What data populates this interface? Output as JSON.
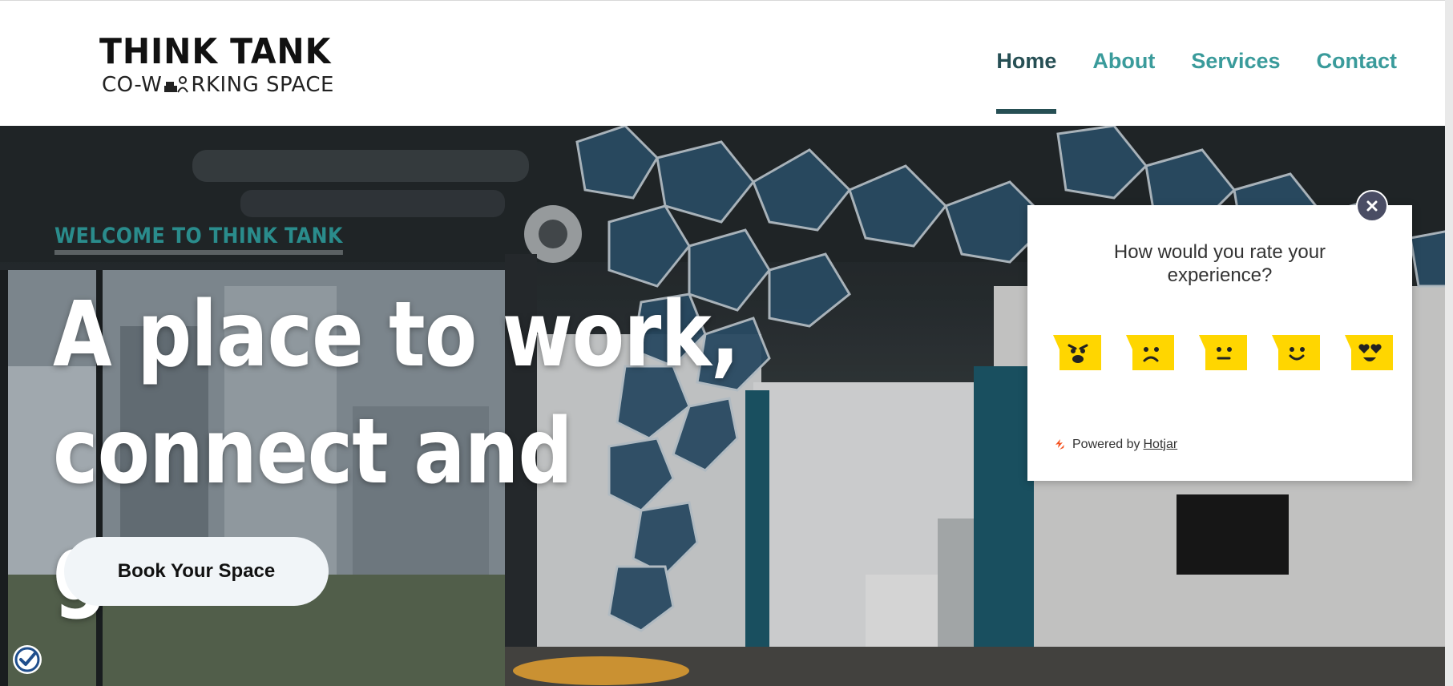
{
  "brand": {
    "title": "THINK TANK",
    "subtitle_left": "CO-W",
    "subtitle_right": "RKING SPACE",
    "accent_color": "#3a9b9b",
    "dark_color": "#264f54"
  },
  "nav": {
    "items": [
      {
        "label": "Home",
        "active": true
      },
      {
        "label": "About",
        "active": false
      },
      {
        "label": "Services",
        "active": false
      },
      {
        "label": "Contact",
        "active": false
      }
    ]
  },
  "hero": {
    "eyebrow": "WELCOME TO THINK TANK",
    "headline_line1": "A place to work,",
    "headline_line2": "connect and grow",
    "cta_label": "Book Your Space",
    "badge_icon": "shield-check-icon"
  },
  "survey": {
    "question": "How would you rate your experience?",
    "close_icon": "close-icon",
    "ratings": [
      "angry-face-icon",
      "sad-face-icon",
      "neutral-face-icon",
      "happy-face-icon",
      "love-face-icon"
    ],
    "powered_prefix": "Powered by",
    "powered_link": "Hotjar",
    "emoji_color": "#ffd600"
  }
}
